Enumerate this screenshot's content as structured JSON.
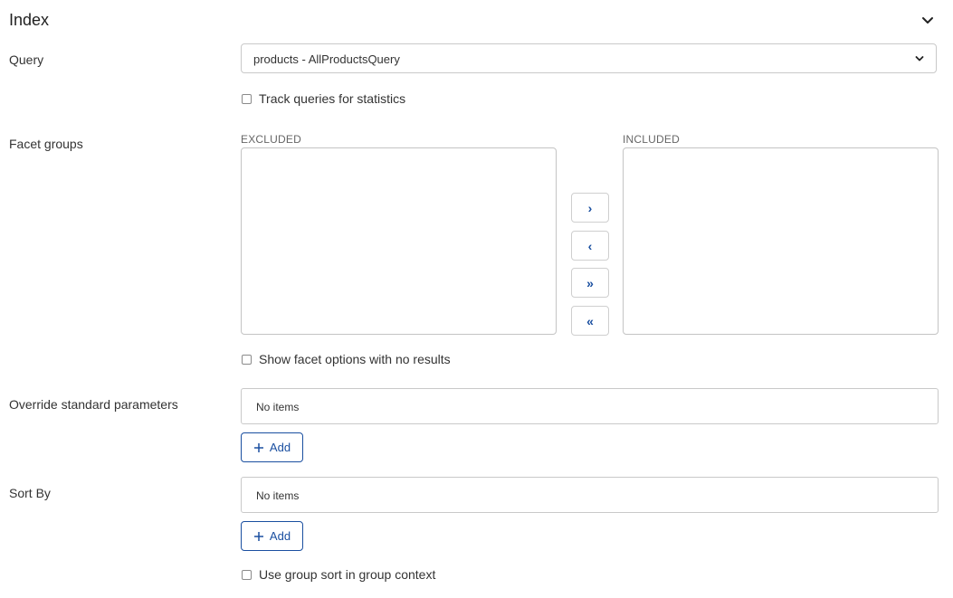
{
  "section": {
    "title": "Index",
    "collapse_icon": "chevron-down-icon"
  },
  "query": {
    "label": "Query",
    "selected_value": "products - AllProductsQuery",
    "chevron_icon": "chevron-down-icon"
  },
  "track_queries": {
    "label": "Track queries for statistics",
    "checked": false
  },
  "facet_groups": {
    "label": "Facet groups",
    "excluded_label": "EXCLUDED",
    "included_label": "INCLUDED",
    "excluded_items": [],
    "included_items": [],
    "buttons": {
      "move_right": "›",
      "move_left": "‹",
      "move_all_right": "»",
      "move_all_left": "«"
    }
  },
  "show_facet_options": {
    "label": "Show facet options with no results",
    "checked": false
  },
  "override_params": {
    "label": "Override standard parameters",
    "empty_text": "No items",
    "add_label": "Add"
  },
  "sort_by": {
    "label": "Sort By",
    "empty_text": "No items",
    "add_label": "Add"
  },
  "group_sort": {
    "label": "Use group sort in group context",
    "checked": false
  },
  "colors": {
    "accent": "#1a4fa0",
    "border": "#c9c9c9",
    "text": "#333333"
  }
}
